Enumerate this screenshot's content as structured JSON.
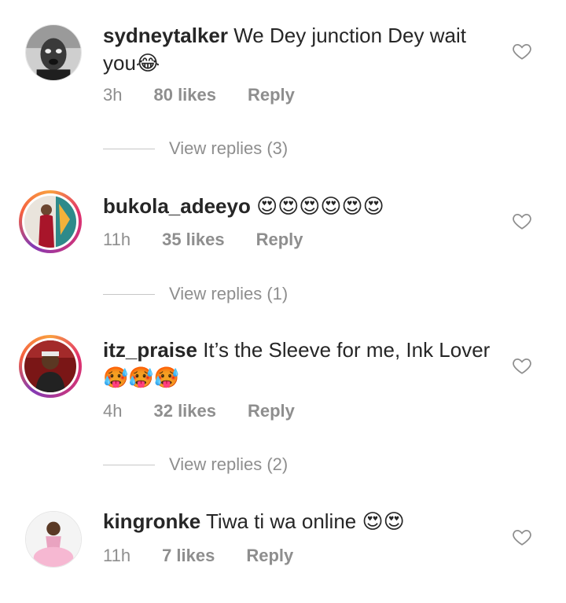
{
  "comments": [
    {
      "username": "sydneytalker",
      "text": "We Dey junction Dey wait you",
      "emoji": "😂",
      "time": "3h",
      "likes": "80 likes",
      "reply": "Reply",
      "view_replies": "View replies (3)"
    },
    {
      "username": "bukola_adeeyo",
      "text": "",
      "emoji": "😍😍😍😍😍😍",
      "time": "11h",
      "likes": "35 likes",
      "reply": "Reply",
      "view_replies": "View replies (1)"
    },
    {
      "username": "itz_praise",
      "text": "It’s the Sleeve for me, Ink Lover",
      "emoji": "🥵🥵🥵",
      "time": "4h",
      "likes": "32 likes",
      "reply": "Reply",
      "view_replies": "View replies (2)"
    },
    {
      "username": "kingronke",
      "text": "Tiwa ti wa online",
      "emoji": "😍😍",
      "time": "11h",
      "likes": "7 likes",
      "reply": "Reply"
    }
  ],
  "icons": {
    "like": "heart-outline-icon"
  },
  "colors": {
    "story_ring_start": "#f9a03f",
    "story_ring_end": "#c13584",
    "muted_text": "#8e8e8e"
  }
}
